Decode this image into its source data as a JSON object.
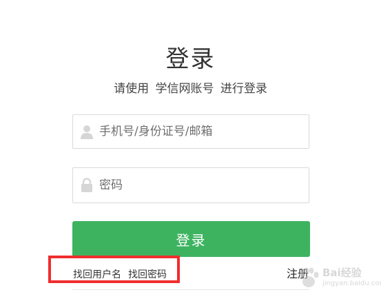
{
  "login": {
    "title": "登录",
    "subtitle": "请使用 学信网账号 进行登录",
    "username_placeholder": "手机号/身份证号/邮箱",
    "password_placeholder": "密码",
    "submit_label": "登录"
  },
  "links": {
    "find_username": "找回用户名",
    "find_password": "找回密码",
    "register": "注册"
  },
  "watermark": {
    "text": "Bai经验",
    "url": "jingyan.baidu.com"
  },
  "colors": {
    "accent": "#3db360",
    "highlight": "#f02d2d",
    "border": "#d9d9d9"
  },
  "icons": {
    "username": "user-icon",
    "password": "lock-icon",
    "watermark": "paw-icon"
  }
}
